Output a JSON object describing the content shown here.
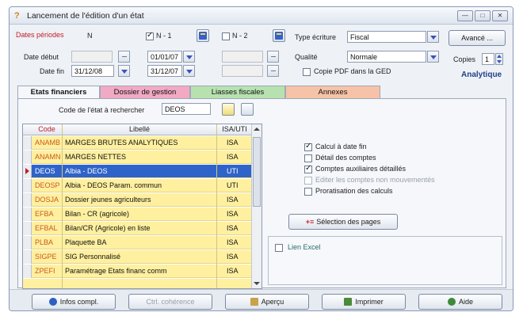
{
  "window": {
    "title": "Lancement de l'édition d'un état",
    "app_icon": "?"
  },
  "titlebar_buttons": [
    "minimize",
    "maximize",
    "close"
  ],
  "dates": {
    "title": "Dates périodes",
    "col_n": "N",
    "col_n1_label": "N - 1",
    "col_n1_checked": true,
    "col_n2_label": "N - 2",
    "col_n2_checked": false,
    "date_debut_label": "Date début",
    "date_fin_label": "Date fin",
    "n_debut": "",
    "n_fin": "31/12/08",
    "n1_debut": "01/01/07",
    "n1_fin": "31/12/07",
    "n2_debut": "",
    "n2_fin": ""
  },
  "options": {
    "type_ecriture_label": "Type écriture",
    "type_ecriture_value": "Fiscal",
    "qualite_label": "Qualité",
    "qualite_value": "Normale",
    "copie_pdf_label": "Copie PDF dans la GED",
    "copie_pdf_checked": false,
    "avance_label": "Avancé ...",
    "copies_label": "Copies",
    "copies_value": "1",
    "analytique_label": "Analytique"
  },
  "tabs": [
    {
      "label": "Etats financiers",
      "color": "#f5f7fb",
      "active": true
    },
    {
      "label": "Dossier de gestion",
      "color": "#f2a9c4",
      "active": false
    },
    {
      "label": "Liasses fiscales",
      "color": "#b7e2b0",
      "active": false
    },
    {
      "label": "Annexes",
      "color": "#f6c3a8",
      "active": false
    }
  ],
  "search": {
    "label": "Code de l'état à rechercher",
    "value": "DEOS"
  },
  "grid": {
    "headers": [
      "Code",
      "Libellé",
      "ISA/UTI"
    ],
    "rows": [
      {
        "code": "ANAMB",
        "libelle": "MARGES BRUTES ANALYTIQUES",
        "type": "ISA",
        "selected": false
      },
      {
        "code": "ANAMN",
        "libelle": "MARGES NETTES",
        "type": "ISA",
        "selected": false
      },
      {
        "code": "DEOS",
        "libelle": "Albia - DEOS",
        "type": "UTI",
        "selected": true
      },
      {
        "code": "DEOSP",
        "libelle": "Albia - DEOS Param. commun",
        "type": "UTI",
        "selected": false
      },
      {
        "code": "DOSJA",
        "libelle": "Dossier jeunes agriculteurs",
        "type": "ISA",
        "selected": false
      },
      {
        "code": "EFBA",
        "libelle": "Bilan - CR (agricole)",
        "type": "ISA",
        "selected": false
      },
      {
        "code": "EFBAL",
        "libelle": "Bilan/CR (Agricole) en liste",
        "type": "ISA",
        "selected": false
      },
      {
        "code": "PLBA",
        "libelle": "Plaquette BA",
        "type": "ISA",
        "selected": false
      },
      {
        "code": "SIGPE",
        "libelle": "SIG Personnalisé",
        "type": "ISA",
        "selected": false
      },
      {
        "code": "ZPEFI",
        "libelle": "Paramétrage Etats financ comm",
        "type": "ISA",
        "selected": false
      }
    ]
  },
  "right_panel": {
    "checkboxes": [
      {
        "label": "Calcul à date fin",
        "checked": true,
        "disabled": false
      },
      {
        "label": "Détail des comptes",
        "checked": false,
        "disabled": false
      },
      {
        "label": "Comptes auxiliaires détaillés",
        "checked": true,
        "disabled": false
      },
      {
        "label": "Editer les comptes non mouvementés",
        "checked": false,
        "disabled": true
      },
      {
        "label": "Proratisation des calculs",
        "checked": false,
        "disabled": false
      }
    ],
    "selection_pages_label": "Sélection des pages",
    "lien_excel_label": "Lien Excel",
    "lien_excel_checked": false
  },
  "bottom_buttons": [
    {
      "label": "Infos compl.",
      "icon": "info-icon",
      "disabled": false
    },
    {
      "label": "Ctrl. cohérence",
      "icon": "",
      "disabled": true
    },
    {
      "label": "Aperçu",
      "icon": "preview-icon",
      "disabled": false
    },
    {
      "label": "Imprimer",
      "icon": "printer-icon",
      "disabled": false
    },
    {
      "label": "Aide",
      "icon": "help-icon",
      "disabled": false
    }
  ],
  "colors": {
    "row_bg": "#fff0a0",
    "selected_row": "#2e63c9",
    "code_text": "#c85a1a",
    "accent_red": "#c0202a",
    "accent_blue": "#213f8a"
  }
}
